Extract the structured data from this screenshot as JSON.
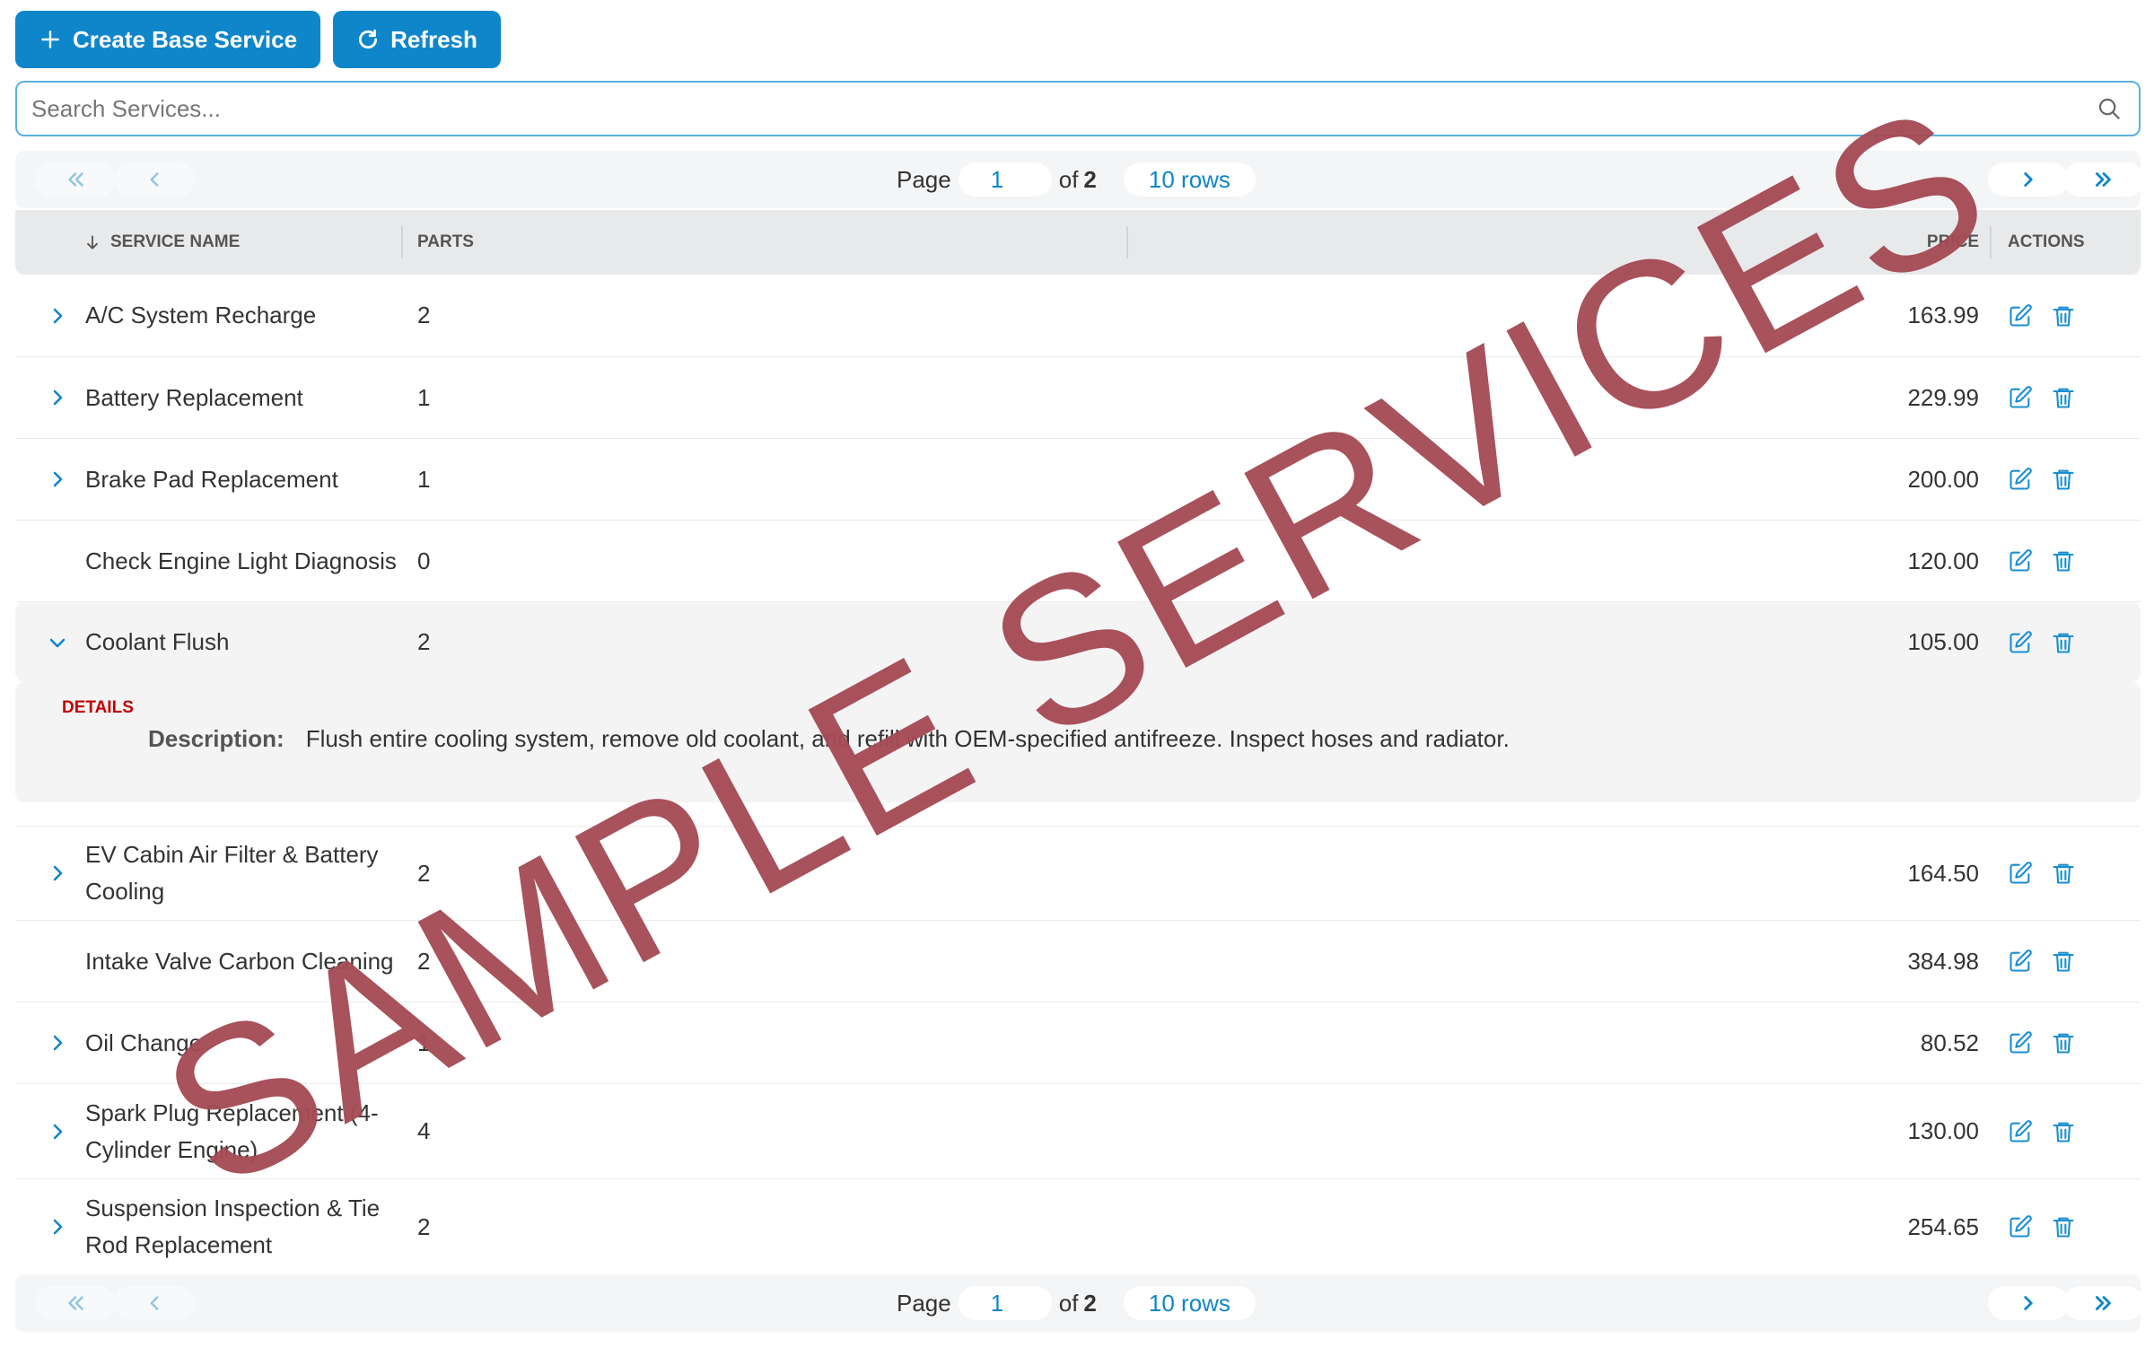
{
  "toolbar": {
    "create_label": "Create Base Service",
    "refresh_label": "Refresh"
  },
  "search": {
    "placeholder": "Search Services..."
  },
  "pager": {
    "page_label": "Page",
    "page_value": "1",
    "of_label": "of",
    "total_pages": "2",
    "rows_label": "10 rows"
  },
  "table": {
    "headers": {
      "service_name": "SERVICE NAME",
      "parts": "PARTS",
      "price": "PRICE",
      "actions": "ACTIONS"
    },
    "rows": [
      {
        "name": "A/C System Recharge",
        "parts": "2",
        "price": "163.99"
      },
      {
        "name": "Battery Replacement",
        "parts": "1",
        "price": "229.99"
      },
      {
        "name": "Brake Pad Replacement",
        "parts": "1",
        "price": "200.00"
      },
      {
        "name": "Check Engine Light Diagnosis",
        "parts": "0",
        "price": "120.00"
      },
      {
        "name": "Coolant Flush",
        "parts": "2",
        "price": "105.00"
      },
      {
        "name": "EV Cabin Air Filter & Battery Cooling",
        "parts": "2",
        "price": "164.50"
      },
      {
        "name": "Intake Valve Carbon Cleaning",
        "parts": "2",
        "price": "384.98"
      },
      {
        "name": "Oil Change",
        "parts": "1",
        "price": "80.52"
      },
      {
        "name": "Spark Plug Replacement (4-Cylinder Engine)",
        "parts": "4",
        "price": "130.00"
      },
      {
        "name": "Suspension Inspection & Tie Rod Replacement",
        "parts": "2",
        "price": "254.65"
      }
    ]
  },
  "details": {
    "label": "DETAILS",
    "description_label": "Description:",
    "description": "Flush entire cooling system, remove old coolant, and refill with OEM-specified antifreeze. Inspect hoses and radiator."
  },
  "watermark": "SAMPLE SERVICES",
  "colors": {
    "accent": "#0f86c9",
    "details_label": "#c00000",
    "watermark": "#a54b55"
  }
}
